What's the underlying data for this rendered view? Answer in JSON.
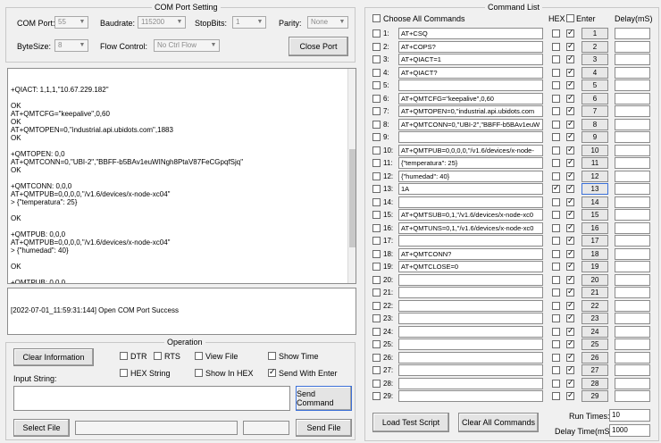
{
  "com_setting": {
    "title": "COM Port Setting",
    "com_port_label": "COM Port:",
    "com_port_value": "55",
    "baudrate_label": "Baudrate:",
    "baudrate_value": "115200",
    "stopbits_label": "StopBits:",
    "stopbits_value": "1",
    "parity_label": "Parity:",
    "parity_value": "None",
    "bytesize_label": "ByteSize:",
    "bytesize_value": "8",
    "flow_label": "Flow Control:",
    "flow_value": "No Ctrl Flow",
    "close_port_label": "Close Port"
  },
  "receive_log": {
    "lines": [
      "+QIACT: 1,1,1,\"10.67.229.182\"",
      "",
      "OK",
      "AT+QMTCFG=\"keepalive\",0,60",
      "OK",
      "AT+QMTOPEN=0,\"industrial.api.ubidots.com\",1883",
      "OK",
      "",
      "+QMTOPEN: 0,0",
      "AT+QMTCONN=0,\"UBI-2\",\"BBFF-b5BAv1euWINgh8PtaV87FeCGpqfSjq\"",
      "OK",
      "",
      "+QMTCONN: 0,0,0",
      "AT+QMTPUB=0,0,0,0,\"/v1.6/devices/x-node-xc04\"",
      "> {\"temperatura\": 25}",
      "",
      "OK",
      "",
      "+QMTPUB: 0,0,0",
      "AT+QMTPUB=0,0,0,0,\"/v1.6/devices/x-node-xc04\"",
      "> {\"humedad\": 40}",
      "",
      "OK",
      "",
      "+QMTPUB: 0,0,0"
    ]
  },
  "status_log": {
    "lines": [
      "[2022-07-01_11:59:31:144] Open COM Port Success"
    ]
  },
  "operation": {
    "title": "Operation",
    "clear_info_label": "Clear Information",
    "dtr_label": "DTR",
    "rts_label": "RTS",
    "view_file_label": "View File",
    "show_time_label": "Show Time",
    "hex_string_label": "HEX String",
    "show_in_hex_label": "Show In HEX",
    "send_with_enter_label": "Send With Enter",
    "input_string_label": "Input String:",
    "send_command_label": "Send Command",
    "select_file_label": "Select File",
    "send_file_label": "Send File"
  },
  "command_list": {
    "title": "Command List",
    "choose_all_label": "Choose All Commands",
    "hex_label": "HEX",
    "enter_label": "Enter",
    "delay_label": "Delay(mS)",
    "rows": [
      {
        "num": "1:",
        "cmd": "AT+CSQ",
        "hex": false,
        "enter": true,
        "btn": "1"
      },
      {
        "num": "2:",
        "cmd": "AT+COPS?",
        "hex": false,
        "enter": true,
        "btn": "2"
      },
      {
        "num": "3:",
        "cmd": "AT+QIACT=1",
        "hex": false,
        "enter": true,
        "btn": "3"
      },
      {
        "num": "4:",
        "cmd": "AT+QIACT?",
        "hex": false,
        "enter": true,
        "btn": "4"
      },
      {
        "num": "5:",
        "cmd": "",
        "hex": false,
        "enter": true,
        "btn": "5"
      },
      {
        "num": "6:",
        "cmd": "AT+QMTCFG=\"keepalive\",0,60",
        "hex": false,
        "enter": true,
        "btn": "6"
      },
      {
        "num": "7:",
        "cmd": "AT+QMTOPEN=0,\"industrial.api.ubidots.com",
        "hex": false,
        "enter": true,
        "btn": "7"
      },
      {
        "num": "8:",
        "cmd": "AT+QMTCONN=0,\"UBI-2\",\"BBFF-b5BAv1euW",
        "hex": false,
        "enter": true,
        "btn": "8"
      },
      {
        "num": "9:",
        "cmd": "",
        "hex": false,
        "enter": true,
        "btn": "9"
      },
      {
        "num": "10:",
        "cmd": "AT+QMTPUB=0,0,0,0,\"/v1.6/devices/x-node-",
        "hex": false,
        "enter": true,
        "btn": "10"
      },
      {
        "num": "11:",
        "cmd": "{\"temperatura\": 25}",
        "hex": false,
        "enter": true,
        "btn": "11"
      },
      {
        "num": "12:",
        "cmd": "{\"humedad\": 40}",
        "hex": false,
        "enter": true,
        "btn": "12"
      },
      {
        "num": "13:",
        "cmd": "1A",
        "hex": true,
        "enter": true,
        "btn": "13"
      },
      {
        "num": "14:",
        "cmd": "",
        "hex": false,
        "enter": true,
        "btn": "14"
      },
      {
        "num": "15:",
        "cmd": "AT+QMTSUB=0,1,\"/v1.6/devices/x-node-xc0",
        "hex": false,
        "enter": true,
        "btn": "15"
      },
      {
        "num": "16:",
        "cmd": "AT+QMTUNS=0,1,\"/v1.6/devices/x-node-xc0",
        "hex": false,
        "enter": true,
        "btn": "16"
      },
      {
        "num": "17:",
        "cmd": "",
        "hex": false,
        "enter": true,
        "btn": "17"
      },
      {
        "num": "18:",
        "cmd": "AT+QMTCONN?",
        "hex": false,
        "enter": true,
        "btn": "18"
      },
      {
        "num": "19:",
        "cmd": "AT+QMTCLOSE=0",
        "hex": false,
        "enter": true,
        "btn": "19"
      },
      {
        "num": "20:",
        "cmd": "",
        "hex": false,
        "enter": true,
        "btn": "20"
      },
      {
        "num": "21:",
        "cmd": "",
        "hex": false,
        "enter": true,
        "btn": "21"
      },
      {
        "num": "22:",
        "cmd": "",
        "hex": false,
        "enter": true,
        "btn": "22"
      },
      {
        "num": "23:",
        "cmd": "",
        "hex": false,
        "enter": true,
        "btn": "23"
      },
      {
        "num": "24:",
        "cmd": "",
        "hex": false,
        "enter": true,
        "btn": "24"
      },
      {
        "num": "25:",
        "cmd": "",
        "hex": false,
        "enter": true,
        "btn": "25"
      },
      {
        "num": "26:",
        "cmd": "",
        "hex": false,
        "enter": true,
        "btn": "26"
      },
      {
        "num": "27:",
        "cmd": "",
        "hex": false,
        "enter": true,
        "btn": "27"
      },
      {
        "num": "28:",
        "cmd": "",
        "hex": false,
        "enter": true,
        "btn": "28"
      },
      {
        "num": "29:",
        "cmd": "",
        "hex": false,
        "enter": true,
        "btn": "29"
      }
    ],
    "load_test_script_label": "Load Test Script",
    "clear_all_commands_label": "Clear All Commands",
    "run_times_label": "Run Times:",
    "run_times_value": "10",
    "delay_time_label": "Delay Time(mS):",
    "delay_time_value": "1000"
  }
}
